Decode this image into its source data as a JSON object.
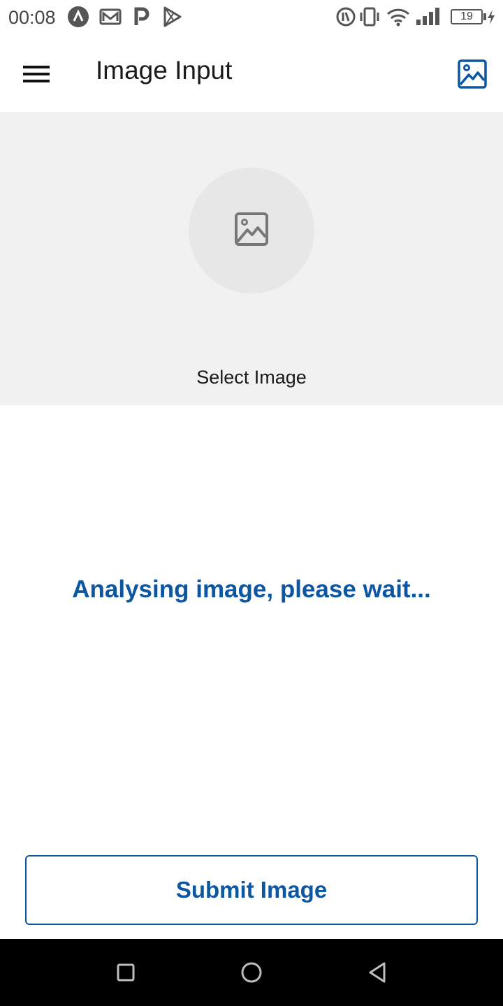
{
  "status_bar": {
    "time": "00:08",
    "battery": "19",
    "left_icons": [
      "app-a-icon",
      "mail-icon",
      "p-app-icon",
      "play-store-icon"
    ],
    "right_icons": [
      "data-saver-icon",
      "vibrate-icon",
      "wifi-icon",
      "signal-icon",
      "battery-icon",
      "charging-icon"
    ]
  },
  "app_bar": {
    "title": "Image Input",
    "menu_icon": "hamburger-menu-icon",
    "action_icon": "image-gallery-icon"
  },
  "image_picker": {
    "label": "Select Image",
    "icon": "image-placeholder-icon"
  },
  "status_message": "Analysing image, please wait...",
  "submit_button": {
    "label": "Submit Image"
  },
  "nav_bar": {
    "icons": [
      "recent-apps-icon",
      "home-icon",
      "back-icon"
    ]
  },
  "colors": {
    "accent": "#0d56a1",
    "panel_bg": "#f1f1f1",
    "circle_bg": "#e7e7e7",
    "text": "#1b1b1b",
    "nav_bg": "#000000"
  }
}
